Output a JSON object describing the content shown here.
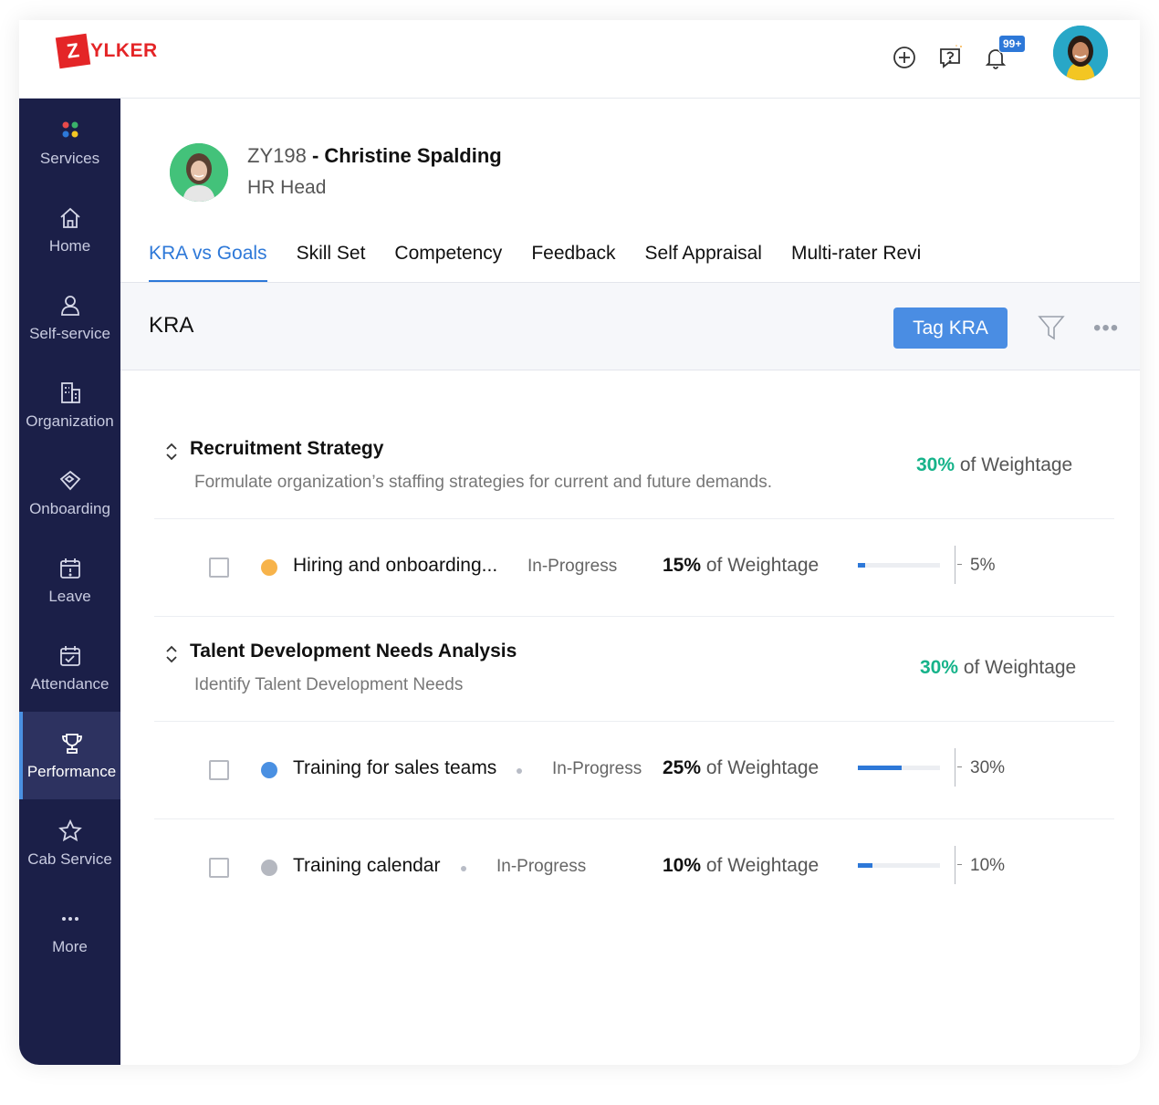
{
  "brand": {
    "logo_letter": "Z",
    "logo_text": "YLKER",
    "color": "#e42527"
  },
  "header": {
    "icons": [
      "add-icon",
      "help-icon",
      "bell-icon"
    ],
    "notification_badge": "99+"
  },
  "sidebar": {
    "items": [
      {
        "label": "Services",
        "icon": "services-icon"
      },
      {
        "label": "Home",
        "icon": "home-icon"
      },
      {
        "label": "Self-service",
        "icon": "user-icon"
      },
      {
        "label": "Organization",
        "icon": "building-icon"
      },
      {
        "label": "Onboarding",
        "icon": "handshake-icon"
      },
      {
        "label": "Leave",
        "icon": "calendar-icon"
      },
      {
        "label": "Attendance",
        "icon": "calendar-check-icon"
      },
      {
        "label": "Performance",
        "icon": "trophy-icon",
        "active": true
      },
      {
        "label": "Cab Service",
        "icon": "star-icon"
      },
      {
        "label": "More",
        "icon": "more-dots-icon"
      }
    ]
  },
  "employee": {
    "id": "ZY198",
    "separator": " - ",
    "name": "Christine Spalding",
    "role": "HR Head"
  },
  "tabs": [
    {
      "label": "KRA vs Goals",
      "active": true
    },
    {
      "label": "Skill Set"
    },
    {
      "label": "Competency"
    },
    {
      "label": "Feedback"
    },
    {
      "label": "Self Appraisal"
    },
    {
      "label": "Multi-rater Revi"
    }
  ],
  "kra": {
    "title": "KRA",
    "tag_button": "Tag KRA"
  },
  "groups": [
    {
      "title": "Recruitment Strategy",
      "description": "Formulate organization’s staffing strategies for current and future demands.",
      "weight_pct": "30%",
      "weight_label": "of Weightage",
      "goals": [
        {
          "name": "Hiring and onboarding...",
          "status": "In-Progress",
          "weight_pct": "15%",
          "weight_label": "of Weightage",
          "progress": 5,
          "progress_label": "5%",
          "dot_color": "#f7b34a"
        }
      ]
    },
    {
      "title": "Talent Development Needs Analysis",
      "description": "Identify Talent Development Needs",
      "weight_pct": "30%",
      "weight_label": "of Weightage",
      "goals": [
        {
          "name": "Training for sales teams",
          "status": "In-Progress",
          "weight_pct": "25%",
          "weight_label": "of Weightage",
          "progress": 30,
          "progress_label": "30%",
          "dot_color": "#4a90e2"
        },
        {
          "name": "Training calendar",
          "status": "In-Progress",
          "weight_pct": "10%",
          "weight_label": "of Weightage",
          "progress": 10,
          "progress_label": "10%",
          "dot_color": "#b5b8c0"
        }
      ]
    }
  ],
  "colors": {
    "sidebar_bg": "#1b1f48",
    "accent": "#2d78d8",
    "weight_green": "#16b38a"
  }
}
